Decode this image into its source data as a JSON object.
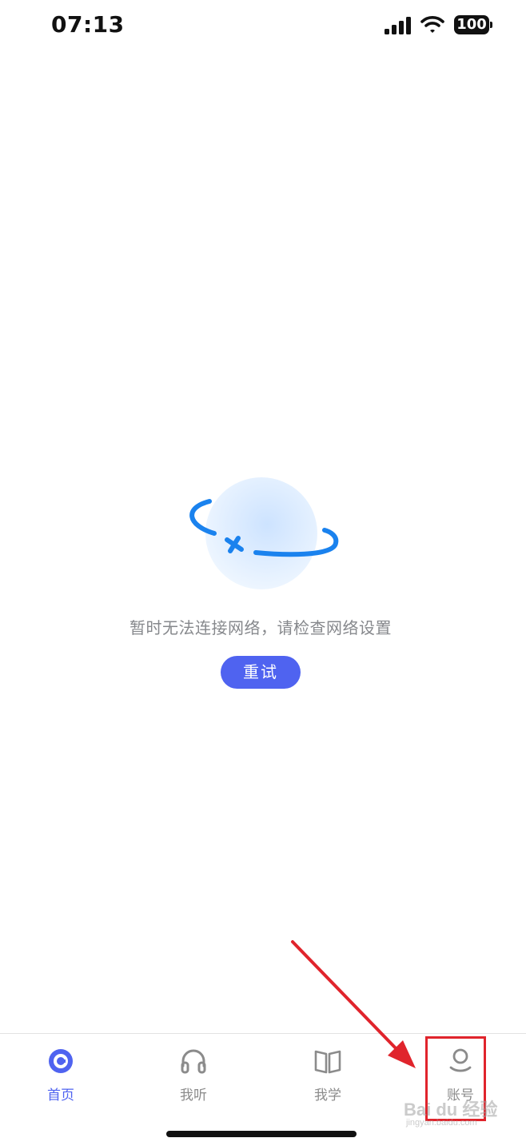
{
  "status_bar": {
    "time": "07:13",
    "battery": "100",
    "icons": [
      "signal-icon",
      "wifi-icon",
      "battery-icon"
    ]
  },
  "empty_state": {
    "illustration": "planet-disconnected-icon",
    "message": "暂时无法连接网络，请检查网络设置",
    "retry_label": "重试"
  },
  "tab_bar": {
    "tabs": [
      {
        "label": "首页",
        "icon": "home-icon",
        "active": true
      },
      {
        "label": "我听",
        "icon": "headphones-icon",
        "active": false
      },
      {
        "label": "我学",
        "icon": "book-icon",
        "active": false
      },
      {
        "label": "账号",
        "icon": "account-icon",
        "active": false
      }
    ]
  },
  "watermark": {
    "text": "Bai du 经验",
    "subtext": "jingyan.baidu.com"
  },
  "colors": {
    "accent": "#4f63f0",
    "illustration_blue": "#1a82ee",
    "annotation_red": "#e0242c",
    "inactive_tab": "#8b8b8b",
    "message_text": "#86888c"
  }
}
